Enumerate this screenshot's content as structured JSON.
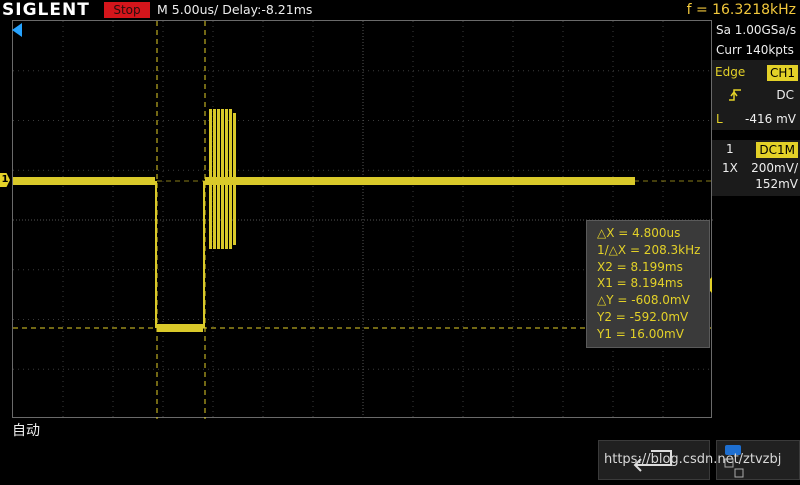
{
  "header": {
    "logo": "SIGLENT",
    "run_state": "Stop",
    "timebase": "M 5.00us/  Delay:-8.21ms",
    "frequency": "f = 16.3218kHz"
  },
  "acquisition": {
    "sample_rate": "Sa 1.00GSa/s",
    "memory_depth": "Curr 140kpts"
  },
  "trigger": {
    "type": "Edge",
    "source": "CH1",
    "slope_icon": "rising-edge-icon",
    "coupling": "DC",
    "level_label": "L",
    "level": "-416 mV"
  },
  "channel1": {
    "number": "1",
    "coupling": "DC1M",
    "probe": "1X",
    "scale": "200mV/",
    "offset": "152mV",
    "marker": "1"
  },
  "cursors": {
    "lines": [
      "△X = 4.800us",
      "1/△X = 208.3kHz",
      "X2 = 8.199ms",
      "X1 = 8.194ms",
      "△Y = -608.0mV",
      "Y2 = -592.0mV",
      "Y1 = 16.00mV"
    ]
  },
  "status": {
    "mode": "自动"
  },
  "footer": {
    "watermark": "https://blog.csdn.net/ztvzbj"
  },
  "colors": {
    "trace": "#e3d128",
    "stop": "#d4151b",
    "accent": "#26a3ff"
  }
}
